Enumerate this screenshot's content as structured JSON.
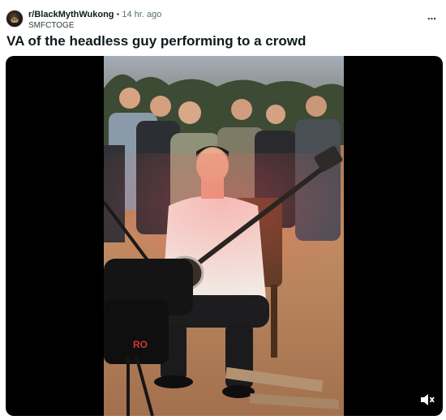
{
  "post": {
    "subreddit": "r/BlackMythWukong",
    "separator": "•",
    "age": "14 hr. ago",
    "author": "SMFCTOGE",
    "title": "VA of the headless guy performing to a crowd",
    "more_icon": "more-options-icon",
    "overflow_glyph": "..."
  },
  "media": {
    "type": "video",
    "mute_icon": "speaker-muted-icon",
    "overlay_text": "RO"
  },
  "colors": {
    "text": "#0f1a1c",
    "muted": "#576f76",
    "letterbox": "#000000",
    "sand": "#b87a52",
    "shirt": "#f2ece6"
  }
}
